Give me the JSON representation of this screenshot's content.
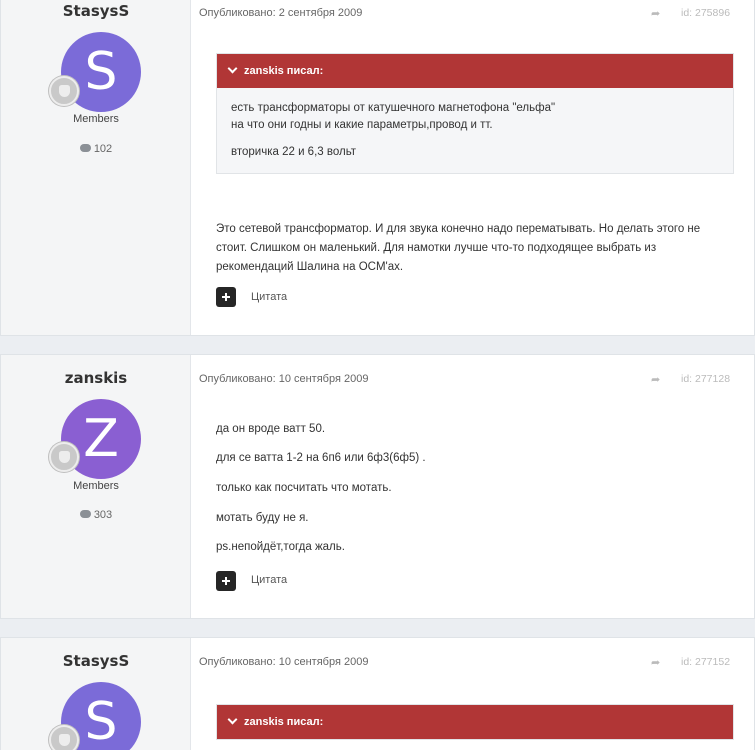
{
  "posts": [
    {
      "author": "StasysS",
      "avatar_letter": "S",
      "group": "Members",
      "post_count": "102",
      "published": "Опубликовано: 2 сентября 2009",
      "post_id": "id: 275896",
      "quote": {
        "author": "zanskis писал:",
        "lines": [
          "есть трансформаторы от катушечного магнетофона \"ельфа\"",
          "на что они годны и какие параметры,провод и тт.",
          "вторичка 22 и 6,3 вольт"
        ]
      },
      "body": "Это сетевой трансформатор. И для звука конечно надо перематывать. Но делать этого не стоит. Слишком он маленький. Для намотки лучше что-то подходящее выбрать из рекомендаций Шалина на OCM'ах.",
      "quote_label": "Цитата"
    },
    {
      "author": "zanskis",
      "avatar_letter": "Z",
      "group": "Members",
      "post_count": "303",
      "published": "Опубликовано: 10 сентября 2009",
      "post_id": "id: 277128",
      "lines": [
        "да он вроде ватт 50.",
        "для се ватта 1-2 на 6п6 или 6ф3(6ф5) .",
        "только как посчитать что мотать.",
        "мотать буду не я.",
        "ps.непойдёт,тогда жаль."
      ],
      "quote_label": "Цитата"
    },
    {
      "author": "StasysS",
      "avatar_letter": "S",
      "published": "Опубликовано: 10 сентября 2009",
      "post_id": "id: 277152",
      "quote": {
        "author": "zanskis писал:"
      }
    }
  ],
  "icons": {
    "share": "share-icon",
    "comment": "comment-icon",
    "rank": "rank-badge-icon",
    "add": "plus-icon",
    "chevron": "chevron-down-icon"
  },
  "colors": {
    "quote_header": "#b13636",
    "avatar_s": "#7b6bd8",
    "avatar_z": "#8a5fd2"
  }
}
